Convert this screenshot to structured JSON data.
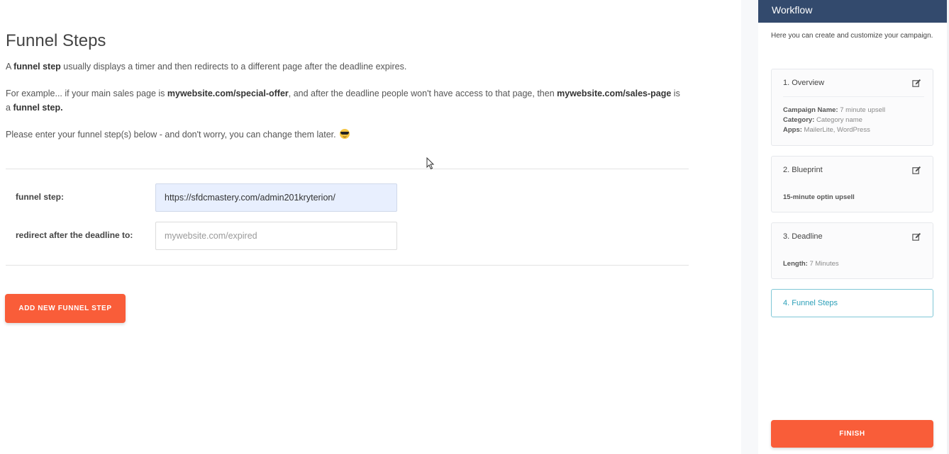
{
  "main": {
    "title": "Funnel Steps",
    "intro": {
      "prefix": "A ",
      "bold": "funnel step",
      "suffix": " usually displays a timer and then redirects to a different page after the deadline expires."
    },
    "example": {
      "part1": "For example... if your main sales page is ",
      "bold1": "mywebsite.com/special-offer",
      "part2": ", and after the deadline people won't have access to that page, then  ",
      "bold2": "mywebsite.com/sales-page",
      "part3": " is a ",
      "bold3": "funnel step.",
      "part4": ""
    },
    "instruction": "Please enter your funnel step(s) below - and don't worry, you can change them later.",
    "instruction_icon": "sunglasses-emoji",
    "funnel_step_label": "funnel step:",
    "funnel_step_value": "https://sfdcmastery.com/admin201kryterion/",
    "redirect_label": "redirect after the deadline to:",
    "redirect_placeholder": "mywebsite.com/expired",
    "add_button": "ADD NEW FUNNEL STEP"
  },
  "sidebar": {
    "header": "Workflow",
    "intro": "Here you can create and customize your campaign.",
    "cards": [
      {
        "title": "1. Overview",
        "lines": [
          {
            "label": "Campaign Name:",
            "value": " 7 minute upsell"
          },
          {
            "label": "Category:",
            "value": " Category name"
          },
          {
            "label": "Apps:",
            "value": " MailerLite, WordPress"
          }
        ]
      },
      {
        "title": "2. Blueprint",
        "text": "15-minute optin upsell"
      },
      {
        "title": "3. Deadline",
        "lines": [
          {
            "label": "Length:",
            "value": " 7 Minutes"
          }
        ]
      },
      {
        "title": "4. Funnel Steps"
      }
    ],
    "finish_button": "FINISH"
  },
  "colors": {
    "accent": "#f95d39",
    "header_bg": "#334a6d",
    "active_step": "#2b9fb8",
    "input_highlight": "#e8effe"
  }
}
